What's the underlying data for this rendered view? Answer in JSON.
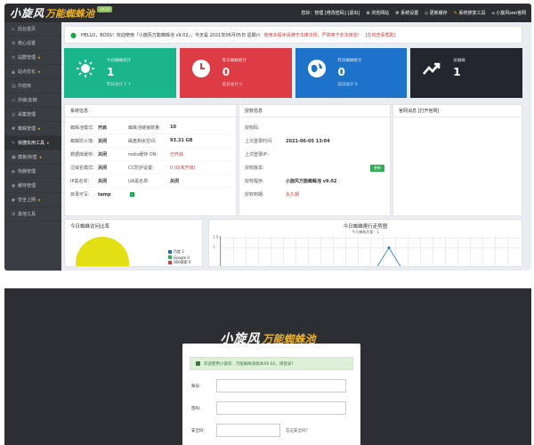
{
  "dashboard": {
    "logo_main": "小旋风",
    "logo_brand": "万能蜘蛛池",
    "logo_version": "v9.02",
    "topnav": [
      "您好：管理 [修改密码] [退出]",
      "浏览网站",
      "系统设置",
      "更新缓存",
      "系统修复工具",
      "小旋风seo官网"
    ],
    "sidebar": [
      {
        "label": "后台首页",
        "icon": "home-icon",
        "glyph": "⌂",
        "star": false,
        "active": false
      },
      {
        "label": "核心设置",
        "icon": "gear-icon",
        "glyph": "⚙",
        "star": false,
        "active": false
      },
      {
        "label": "站群管理",
        "icon": "sites-icon",
        "glyph": "≡",
        "star": true,
        "active": false
      },
      {
        "label": "站点优化",
        "icon": "chart-icon",
        "glyph": "▲",
        "star": true,
        "active": false
      },
      {
        "label": "内容库",
        "icon": "book-icon",
        "glyph": "▤",
        "star": false,
        "active": false
      },
      {
        "label": "外链/友链",
        "icon": "link-icon",
        "glyph": "∞",
        "star": false,
        "active": false
      },
      {
        "label": "采集管理",
        "icon": "collect-icon",
        "glyph": "◎",
        "star": false,
        "active": false
      },
      {
        "label": "蜘蛛管理",
        "icon": "spider-icon",
        "glyph": "✱",
        "star": true,
        "active": false
      },
      {
        "label": "快捷实用工具",
        "icon": "tool-icon",
        "glyph": "✎",
        "star": true,
        "active": true
      },
      {
        "label": "模板/标签",
        "icon": "template-icon",
        "glyph": "▣",
        "star": true,
        "active": false
      },
      {
        "label": "伪静管理",
        "icon": "rewrite-icon",
        "glyph": "◈",
        "star": false,
        "active": false
      },
      {
        "label": "缓存管理",
        "icon": "cache-icon",
        "glyph": "◉",
        "star": false,
        "active": false
      },
      {
        "label": "安全上网",
        "icon": "shield-icon",
        "glyph": "◆",
        "star": true,
        "active": false
      },
      {
        "label": "其他工具",
        "icon": "grid-icon",
        "glyph": "⊞",
        "star": false,
        "active": false
      }
    ],
    "notice": {
      "greeting": "HELLO，BOSS！欢迎使用「小旋风万能蜘蛛池 v9.02」，今天是 2021年06月05日 星期六",
      "warn1": "使用本程序请遵守法律法规，严禁用于非法用途！",
      "link1": "[在线查看帮助]"
    },
    "cards": [
      {
        "title": "今日蜘蛛统计",
        "value": "1",
        "sub": "昨日总计 1 ↑",
        "color": "#1bb58c",
        "icon": "sun-icon"
      },
      {
        "title": "昨日蜘蛛统计",
        "value": "0",
        "sub": "前日总计 0",
        "color": "#de3c45",
        "icon": "clock-icon"
      },
      {
        "title": "昨日蜘蛛统计",
        "value": "0",
        "sub": "前日总计 0",
        "color": "#1e73c8",
        "icon": "globe-icon"
      },
      {
        "title": "总蜘蛛",
        "value": "1",
        "sub": "",
        "color": "#22272e",
        "icon": "trend-icon"
      }
    ],
    "system": {
      "title": "系统信息",
      "rows": [
        {
          "k1": "蜘蛛池模式:",
          "v1": "开启",
          "k2": "蜘蛛池链接数量:",
          "v2": "10",
          "red1": false,
          "red2": false
        },
        {
          "k1": "蜘蛛防火墙:",
          "v1": "关闭",
          "k2": "磁盘剩余空间:",
          "v2": "93.31 GB",
          "red1": false,
          "red2": false
        },
        {
          "k1": "数据库缓存:",
          "v1": "关闭",
          "k2": "redis缓存 ON:",
          "v2": "已开启",
          "red1": false,
          "red2": true
        },
        {
          "k1": "泛域名模式:",
          "v1": "关闭",
          "k2": "CC防护设置:",
          "v2": "0 (0/未开启)",
          "red1": false,
          "red2": true
        },
        {
          "k1": "IP黑名单:",
          "v1": "关闭",
          "k2": "UA黑名单:",
          "v2": "关闭",
          "red1": false,
          "red2": false
        },
        {
          "k1": "目录可写:",
          "v1": "temp",
          "k2": "",
          "v2": "",
          "red1": false,
          "red2": false
        }
      ]
    },
    "auth": {
      "title": "授权信息",
      "rows": [
        {
          "k": "授权码:",
          "v": "",
          "red": false,
          "button": ""
        },
        {
          "k": "上次登录时间:",
          "v": "2021-06-05 13:04",
          "red": false,
          "button": ""
        },
        {
          "k": "上次登录IP:",
          "v": "",
          "red": false,
          "button": ""
        },
        {
          "k": "授权版本:",
          "v": "",
          "red": false,
          "button": "更新"
        },
        {
          "k": "授权程序:",
          "v": "小旋风万能蜘蛛池 v9.02",
          "red": false,
          "button": ""
        },
        {
          "k": "授权到期:",
          "v": "永久期",
          "red": true,
          "button": ""
        }
      ]
    },
    "site": {
      "title": "官网消息 [打开官网]"
    },
    "pie_chart": {
      "title": "今日蜘蛛访问比率",
      "legend": [
        {
          "name": "百度 1",
          "color": "#1e73c8"
        },
        {
          "name": "Google 0",
          "color": "#2eae55"
        },
        {
          "name": "360搜索 0",
          "color": "#de3c45"
        }
      ]
    },
    "line_chart": {
      "title": "今日蜘蛛爬行走势图",
      "subtitle": "今日蜘蛛总量：1",
      "y_ticks": [
        "1.5",
        "1"
      ]
    }
  },
  "chart_data": [
    {
      "type": "pie",
      "title": "今日蜘蛛访问比率",
      "categories": [
        "百度",
        "Google",
        "360搜索"
      ],
      "values": [
        1,
        0,
        0
      ]
    },
    {
      "type": "line",
      "title": "今日蜘蛛爬行走势图",
      "subtitle": "今日蜘蛛总量：1",
      "ylim": [
        0,
        1.5
      ],
      "series": [
        {
          "name": "",
          "values": [
            0,
            0,
            0,
            0,
            0,
            0,
            0,
            0,
            0,
            0,
            0,
            0,
            0,
            1,
            0,
            0,
            0,
            0,
            0,
            0,
            0,
            0,
            0,
            0
          ]
        }
      ]
    }
  ],
  "login": {
    "logo_main": "小旋风",
    "logo_brand": "万能蜘蛛池",
    "alert": "欢迎使用小旋风 · 万能蜘蛛池版本X9.02，请登录！",
    "username_label": "账号:",
    "password_label": "密码:",
    "code_label": "安全码:",
    "forgot": "忘记安全码?"
  }
}
